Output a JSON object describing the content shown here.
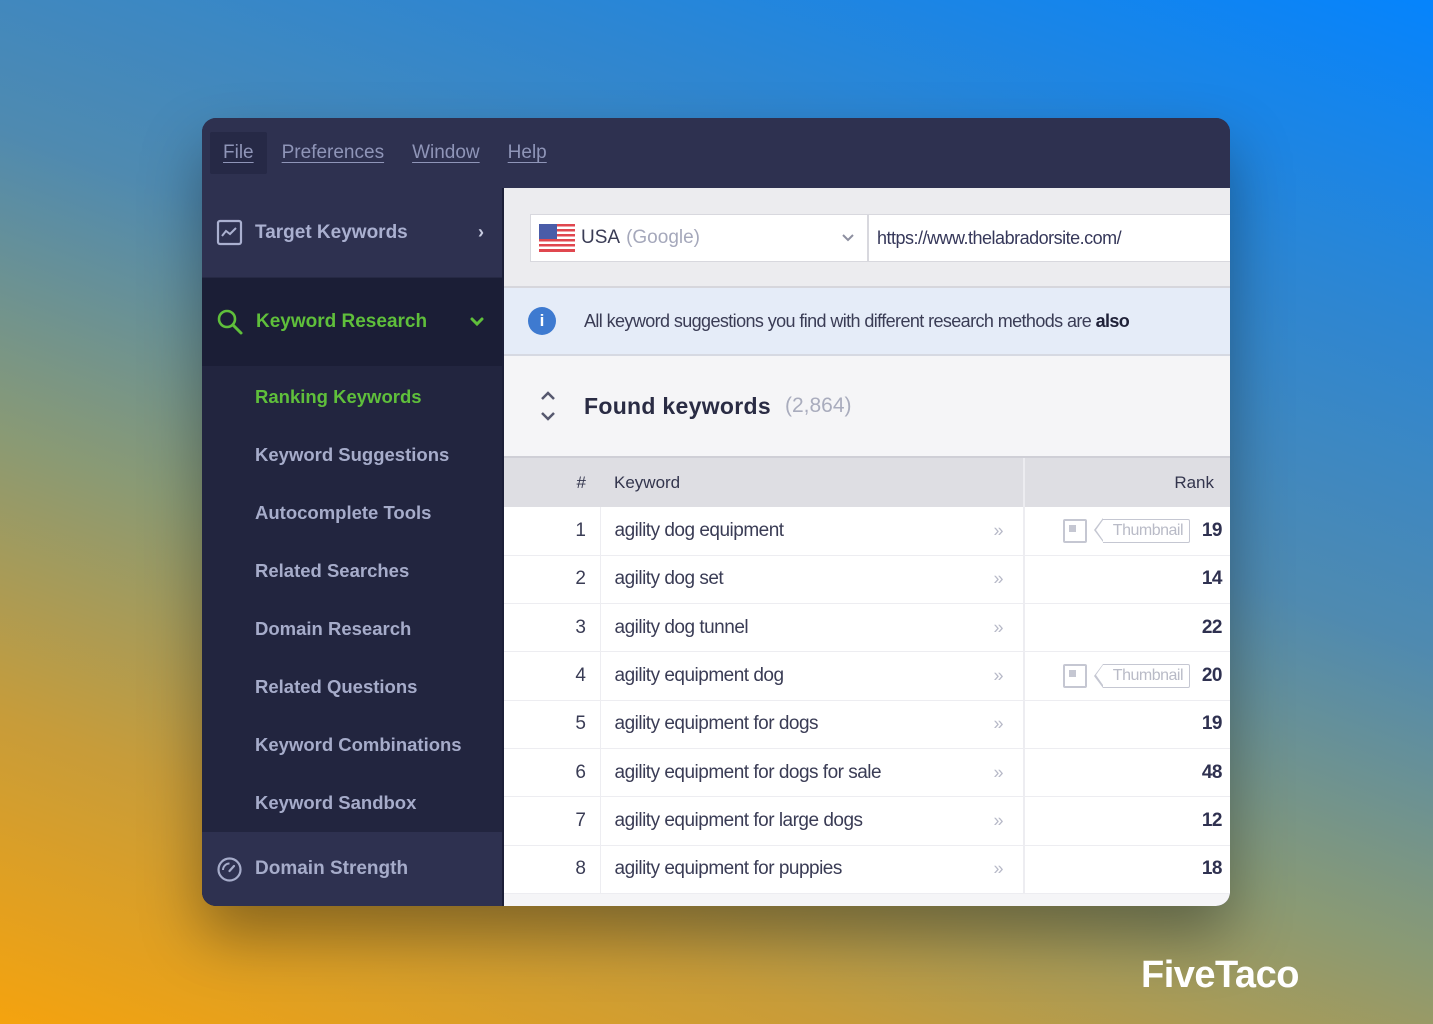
{
  "menubar": {
    "items": [
      {
        "label": "File",
        "active": true
      },
      {
        "label": "Preferences"
      },
      {
        "label": "Window"
      },
      {
        "label": "Help"
      }
    ]
  },
  "sidebar": {
    "top_item": {
      "label": "Target Keywords",
      "icon": "chart-icon"
    },
    "section": {
      "label": "Keyword Research",
      "icon": "search-icon",
      "expanded": true
    },
    "sub_items": [
      {
        "label": "Ranking Keywords",
        "active": true
      },
      {
        "label": "Keyword Suggestions"
      },
      {
        "label": "Autocomplete Tools"
      },
      {
        "label": "Related Searches"
      },
      {
        "label": "Domain Research"
      },
      {
        "label": "Related Questions"
      },
      {
        "label": "Keyword Combinations"
      },
      {
        "label": "Keyword Sandbox"
      }
    ],
    "bottom_item": {
      "label": "Domain Strength",
      "icon": "gauge-icon"
    }
  },
  "toolbar": {
    "country": "USA",
    "engine": "(Google)",
    "url": "https://www.thelabradorsite.com/"
  },
  "info_bar": {
    "text": "All keyword suggestions you find with different research methods are ",
    "bold_text": "also"
  },
  "found": {
    "title": "Found keywords",
    "count": "(2,864)"
  },
  "table": {
    "columns": [
      "#",
      "Keyword",
      "Rank"
    ],
    "thumbnail_label": "Thumbnail",
    "rows": [
      {
        "num": "1",
        "keyword": "agility dog equipment",
        "rank": "19",
        "thumbnail": true
      },
      {
        "num": "2",
        "keyword": "agility dog set",
        "rank": "14",
        "thumbnail": false
      },
      {
        "num": "3",
        "keyword": "agility dog tunnel",
        "rank": "22",
        "thumbnail": false
      },
      {
        "num": "4",
        "keyword": "agility equipment dog",
        "rank": "20",
        "thumbnail": true
      },
      {
        "num": "5",
        "keyword": "agility equipment for dogs",
        "rank": "19",
        "thumbnail": false
      },
      {
        "num": "6",
        "keyword": "agility equipment for dogs for sale",
        "rank": "48",
        "thumbnail": false
      },
      {
        "num": "7",
        "keyword": "agility equipment for large dogs",
        "rank": "12",
        "thumbnail": false
      },
      {
        "num": "8",
        "keyword": "agility equipment for puppies",
        "rank": "18",
        "thumbnail": false
      }
    ]
  },
  "brand": "FiveTaco",
  "colors": {
    "accent_green": "#5fbf3b",
    "sidebar_bg": "#22253f",
    "menubar_bg": "#2e3150",
    "info_blue": "#3e7ad0"
  }
}
